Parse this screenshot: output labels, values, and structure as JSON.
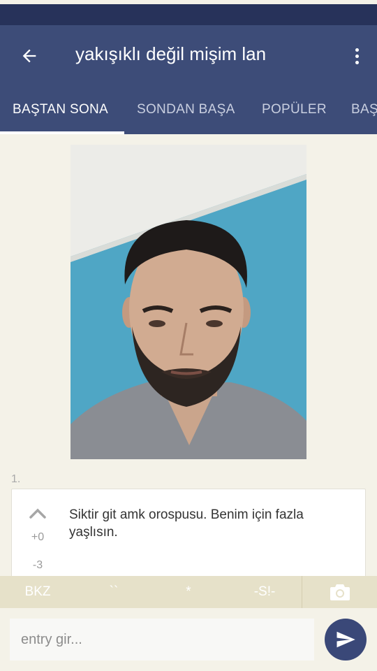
{
  "header": {
    "title": "yakışıklı değil mişim lan",
    "back_icon": "arrow-left-icon",
    "menu_icon": "more-vert-icon"
  },
  "tabs": [
    {
      "label": "BAŞTAN SONA",
      "active": true
    },
    {
      "label": "SONDAN BAŞA",
      "active": false
    },
    {
      "label": "POPÜLER",
      "active": false
    },
    {
      "label": "BAŞ",
      "active": false
    }
  ],
  "entry": {
    "number": "1.",
    "text": "Siktir git amk orospusu. Benim için fazla yaşlısın.",
    "upvotes": "+0",
    "downvotes": "-3",
    "upvote_icon": "chevron-up-icon"
  },
  "format_bar": {
    "bkz": "BKZ",
    "backticks": "``",
    "asterisk": "*",
    "spoiler": "-S!-",
    "camera_icon": "camera-icon"
  },
  "composer": {
    "placeholder": "entry gir...",
    "send_icon": "send-icon"
  },
  "colors": {
    "header_bg": "#3d4c78",
    "status_bg": "#27325a",
    "page_bg": "#f4f2e8",
    "format_bar_bg": "#e6e1c9",
    "send_button_bg": "#3a4878"
  }
}
